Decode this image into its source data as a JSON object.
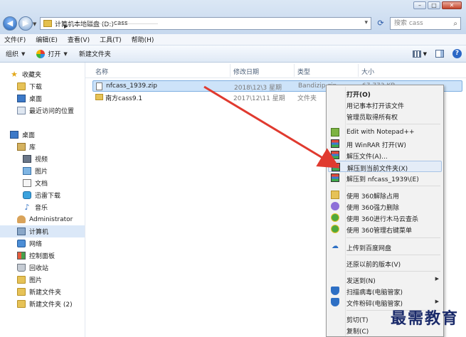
{
  "window": {
    "controls": {
      "minimize": "–",
      "maximize": "□",
      "close": "✕"
    }
  },
  "address": {
    "crumbs": [
      "计算机",
      "本地磁盘 (D:)",
      "cass"
    ],
    "right_glyph": "▾",
    "refresh_glyph": "⟳",
    "back_glyph": "◀",
    "forward_glyph": "▶",
    "search_placeholder": "搜索 cass"
  },
  "menubar": [
    "文件(F)",
    "编辑(E)",
    "查看(V)",
    "工具(T)",
    "帮助(H)"
  ],
  "toolbar": {
    "organize": "组织",
    "open": "打开",
    "new_folder": "新建文件夹",
    "help": "?"
  },
  "sidebar": {
    "items": [
      {
        "label": "收藏夹",
        "icon": "star-icon"
      },
      {
        "label": "下载",
        "icon": "folder-icon"
      },
      {
        "label": "桌面",
        "icon": "desktop-icon"
      },
      {
        "label": "最近访问的位置",
        "icon": "recent-icon"
      },
      {
        "label": "桌面",
        "icon": "desktop-icon"
      },
      {
        "label": "库",
        "icon": "library-icon"
      },
      {
        "label": "视频",
        "icon": "video-icon"
      },
      {
        "label": "图片",
        "icon": "picture-icon"
      },
      {
        "label": "文档",
        "icon": "document-icon"
      },
      {
        "label": "迅雷下载",
        "icon": "download-icon"
      },
      {
        "label": "音乐",
        "icon": "music-icon"
      },
      {
        "label": "Administrator",
        "icon": "user-icon"
      },
      {
        "label": "计算机",
        "icon": "computer-icon"
      },
      {
        "label": "网络",
        "icon": "network-icon"
      },
      {
        "label": "控制面板",
        "icon": "control-panel-icon"
      },
      {
        "label": "回收站",
        "icon": "recycle-bin-icon"
      },
      {
        "label": "图片",
        "icon": "folder-icon"
      },
      {
        "label": "新建文件夹",
        "icon": "folder-icon"
      },
      {
        "label": "新建文件夹 (2)",
        "icon": "folder-icon"
      }
    ]
  },
  "columns": {
    "name": "名称",
    "date": "修改日期",
    "type": "类型",
    "size": "大小"
  },
  "files": [
    {
      "name": "nfcass_1939.zip",
      "date": "2018\\12\\3 星期",
      "type": "Bandizip.zip",
      "size": "67,773 KB"
    },
    {
      "name": "南方cass9.1",
      "date": "2017\\12\\11 星期",
      "type": "文件夹",
      "size": ""
    }
  ],
  "context_menu": [
    {
      "label": "打开(O)",
      "bold": true
    },
    {
      "label": "用记事本打开该文件"
    },
    {
      "label": "管理员取得所有权"
    },
    {
      "separator": true
    },
    {
      "label": "Edit with Notepad++",
      "icon": "notepad-icon"
    },
    {
      "label": "用 WinRAR 打开(W)",
      "icon": "winrar-icon"
    },
    {
      "label": "解压文件(A)...",
      "icon": "winrar-icon"
    },
    {
      "label": "解压到当前文件夹(X)",
      "icon": "winrar-icon",
      "highlight": true
    },
    {
      "label": "解压到 nfcass_1939\\(E)",
      "icon": "winrar-icon"
    },
    {
      "separator": true
    },
    {
      "label": "使用 360解除占用",
      "icon": "folder-icon"
    },
    {
      "label": "使用 360强力删除",
      "icon": "360-delete-icon"
    },
    {
      "label": "使用 360进行木马云查杀",
      "icon": "360-shield-icon"
    },
    {
      "label": "使用 360管理右键菜单",
      "icon": "360-shield-icon"
    },
    {
      "separator": true
    },
    {
      "label": "上传到百度网盘",
      "icon": "cloud-icon"
    },
    {
      "separator": true
    },
    {
      "label": "还原以前的版本(V)"
    },
    {
      "separator": true
    },
    {
      "label": "发送到(N)",
      "submenu": true
    },
    {
      "label": "扫描病毒(电脑管家)",
      "icon": "shield-icon"
    },
    {
      "label": "文件粉碎(电脑管家)",
      "icon": "shield-icon",
      "submenu": true
    },
    {
      "separator": true
    },
    {
      "label": "剪切(T)"
    },
    {
      "label": "复制(C)"
    }
  ],
  "watermark": "最需教育",
  "colors": {
    "arrow": "#e03a2f",
    "selection": "#cde3f9"
  }
}
